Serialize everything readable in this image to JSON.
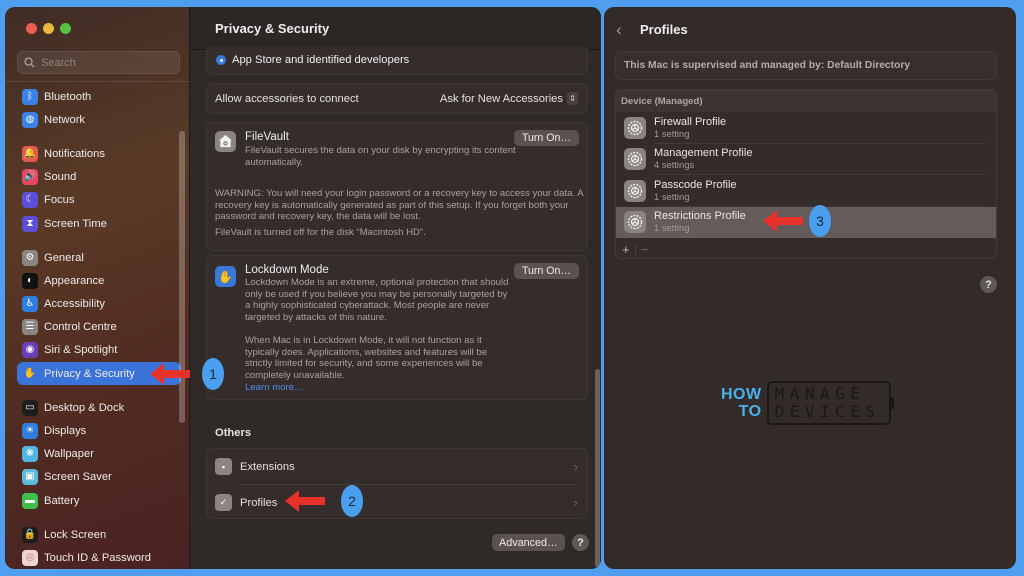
{
  "left_window": {
    "search": {
      "placeholder": "Search"
    },
    "sidebar": {
      "items": [
        {
          "label": "Bluetooth",
          "icon": "bluetooth-icon",
          "color": "#3b82e6",
          "glyph": "ᛒ"
        },
        {
          "label": "Network",
          "icon": "globe-icon",
          "color": "#3b82e6",
          "glyph": "◍"
        },
        {
          "label": "Notifications",
          "icon": "bell-icon",
          "color": "#e45a52",
          "glyph": "🔔"
        },
        {
          "label": "Sound",
          "icon": "speaker-icon",
          "color": "#e8475f",
          "glyph": "🔊"
        },
        {
          "label": "Focus",
          "icon": "moon-icon",
          "color": "#5b4fd6",
          "glyph": "☾"
        },
        {
          "label": "Screen Time",
          "icon": "hourglass-icon",
          "color": "#5b4fd6",
          "glyph": "⧗"
        },
        {
          "label": "General",
          "icon": "gear-icon",
          "color": "#8a8583",
          "glyph": "⚙"
        },
        {
          "label": "Appearance",
          "icon": "appearance-icon",
          "color": "#111111",
          "glyph": "◐"
        },
        {
          "label": "Accessibility",
          "icon": "accessibility-icon",
          "color": "#2f7de0",
          "glyph": "♿"
        },
        {
          "label": "Control Centre",
          "icon": "toggles-icon",
          "color": "#8a8583",
          "glyph": "☰"
        },
        {
          "label": "Siri & Spotlight",
          "icon": "siri-icon",
          "color": "#6a3fb5",
          "glyph": "◉"
        },
        {
          "label": "Privacy & Security",
          "icon": "hand-icon",
          "color": "#3a74d8",
          "glyph": "✋",
          "active": true
        },
        {
          "label": "Desktop & Dock",
          "icon": "dock-icon",
          "color": "#1d1d1d",
          "glyph": "▭"
        },
        {
          "label": "Displays",
          "icon": "sun-icon",
          "color": "#2f7de0",
          "glyph": "☀"
        },
        {
          "label": "Wallpaper",
          "icon": "flower-icon",
          "color": "#4fb6e0",
          "glyph": "❋"
        },
        {
          "label": "Screen Saver",
          "icon": "screen-saver-icon",
          "color": "#5bbad9",
          "glyph": "▣"
        },
        {
          "label": "Battery",
          "icon": "battery-icon",
          "color": "#3fbf4c",
          "glyph": "▬"
        },
        {
          "label": "Lock Screen",
          "icon": "lock-icon",
          "color": "#1d1d1d",
          "glyph": "🔒"
        },
        {
          "label": "Touch ID & Password",
          "icon": "fingerprint-icon",
          "color": "#f0d5d5",
          "glyph": "◎"
        }
      ]
    },
    "main": {
      "title": "Privacy & Security",
      "allow_apps_option": "App Store and identified developers",
      "accessories": {
        "label": "Allow accessories to connect",
        "value": "Ask for New Accessories"
      },
      "filevault": {
        "title": "FileVault",
        "description": "FileVault secures the data on your disk by encrypting its content automatically.",
        "button": "Turn On…",
        "warning": "WARNING: You will need your login password or a recovery key to access your data. A recovery key is automatically generated as part of this setup. If you forget both your password and recovery key, the data will be lost.",
        "status": "FileVault is turned off for the disk “Macintosh HD”."
      },
      "lockdown": {
        "title": "Lockdown Mode",
        "description": "Lockdown Mode is an extreme, optional protection that should only be used if you believe you may be personally targeted by a highly sophisticated cyberattack. Most people are never targeted by attacks of this nature.",
        "description2": "When Mac is in Lockdown Mode, it will not function as it typically does. Applications, websites and features will be strictly limited for security, and some experiences will be completely unavailable.",
        "learn_more": "Learn more…",
        "button": "Turn On…"
      },
      "others": {
        "heading": "Others",
        "items": [
          {
            "label": "Extensions",
            "icon": "puzzle-icon"
          },
          {
            "label": "Profiles",
            "icon": "checkmark-badge-icon"
          }
        ]
      },
      "advanced_button": "Advanced…",
      "help": "?"
    }
  },
  "right_window": {
    "back": "‹",
    "title": "Profiles",
    "supervised_text": "This Mac is supervised and managed by: Default Directory",
    "section_header": "Device (Managed)",
    "profiles": [
      {
        "name": "Firewall Profile",
        "settings": "1 setting"
      },
      {
        "name": "Management Profile",
        "settings": "4 settings"
      },
      {
        "name": "Passcode Profile",
        "settings": "1 setting"
      },
      {
        "name": "Restrictions Profile",
        "settings": "1 setting",
        "selected": true
      }
    ],
    "add": "+",
    "remove": "−",
    "help": "?"
  },
  "annotations": {
    "badges": [
      "1",
      "2",
      "3"
    ],
    "arrow_color": "#e8312a",
    "badge_color": "#4aa0ee"
  },
  "logo": {
    "line1": "HOW",
    "line2": "TO",
    "box_line1": "MANAGE",
    "box_line2": "DEVICES"
  }
}
